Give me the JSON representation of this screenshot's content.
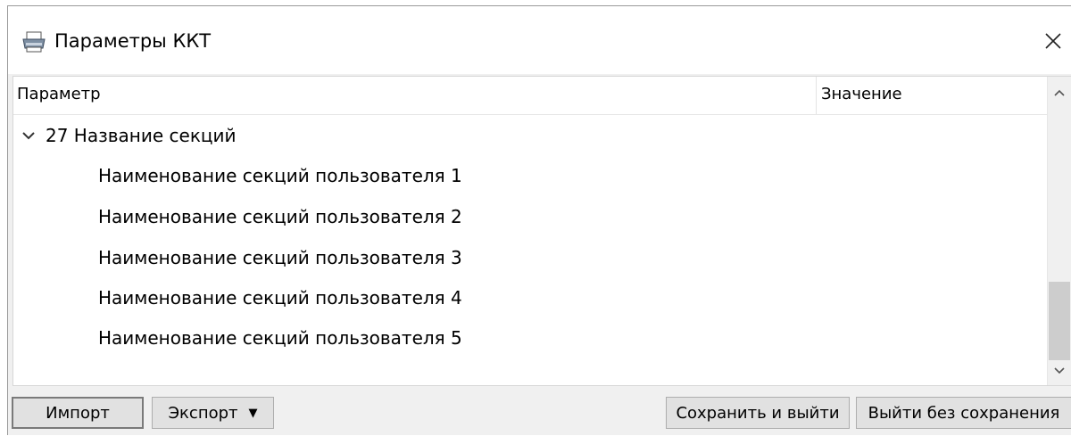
{
  "window": {
    "title": "Параметры ККТ",
    "icon": "printer-icon",
    "close_glyph": "✕"
  },
  "grid": {
    "columns": {
      "param": "Параметр",
      "value": "Значение"
    },
    "group": {
      "label": "27 Название секций",
      "expanded": true
    },
    "items": [
      {
        "label": "Наименование секций пользователя 1",
        "value": ""
      },
      {
        "label": "Наименование секций пользователя 2",
        "value": ""
      },
      {
        "label": "Наименование секций пользователя 3",
        "value": ""
      },
      {
        "label": "Наименование секций пользователя 4",
        "value": ""
      },
      {
        "label": "Наименование секций пользователя 5",
        "value": ""
      }
    ]
  },
  "footer": {
    "import_label": "Импорт",
    "export_label": "Экспорт",
    "save_exit_label": "Сохранить и выйти",
    "exit_no_save_label": "Выйти без сохранения"
  },
  "colors": {
    "window_bg": "#f0f0f0",
    "button_bg": "#e1e1e1",
    "scroll_thumb": "#cdcdcd"
  }
}
